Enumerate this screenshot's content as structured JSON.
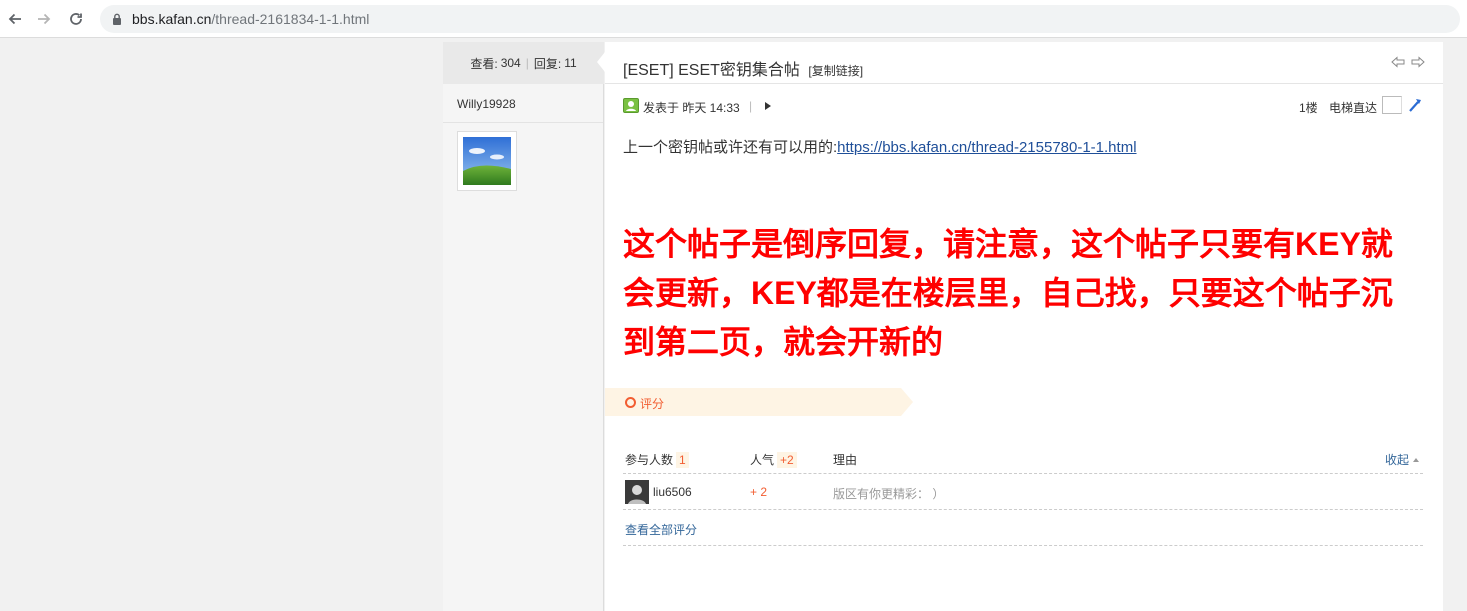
{
  "browser": {
    "url_host": "bbs.kafan.cn",
    "url_path": "/thread-2161834-1-1.html"
  },
  "sidebar": {
    "views_label": "查看:",
    "views_value": "304",
    "replies_label": "回复:",
    "replies_value": "11",
    "author": "Willy19928"
  },
  "thread": {
    "title": "[ESET] ESET密钥集合帖",
    "copy_link": "[复制链接]"
  },
  "post": {
    "posted_label": "发表于 昨天 14:33",
    "separator": "|",
    "floor": "1楼",
    "elevator_label": "电梯直达",
    "intro_text": "上一个密钥帖或许还有可以用的:",
    "intro_link": "https://bbs.kafan.cn/thread-2155780-1-1.html",
    "notice": "这个帖子是倒序回复，请注意，这个帖子只要有KEY就会更新，KEY都是在楼层里，自己找，只要这个帖子沉到第二页，就会开新的"
  },
  "rating": {
    "label": "评分",
    "participants_label": "参与人数",
    "participants_value": "1",
    "popularity_label": "人气",
    "popularity_value": "+2",
    "reason_label": "理由",
    "collapse_label": "收起",
    "rows": [
      {
        "user": "liu6506",
        "points": "+ 2",
        "reason": "版区有你更精彩：  ）"
      }
    ],
    "view_all": "查看全部评分"
  },
  "colors": {
    "accent_orange": "#f25d31",
    "notice_red": "#ff0000",
    "link_blue": "#1f4f99"
  }
}
